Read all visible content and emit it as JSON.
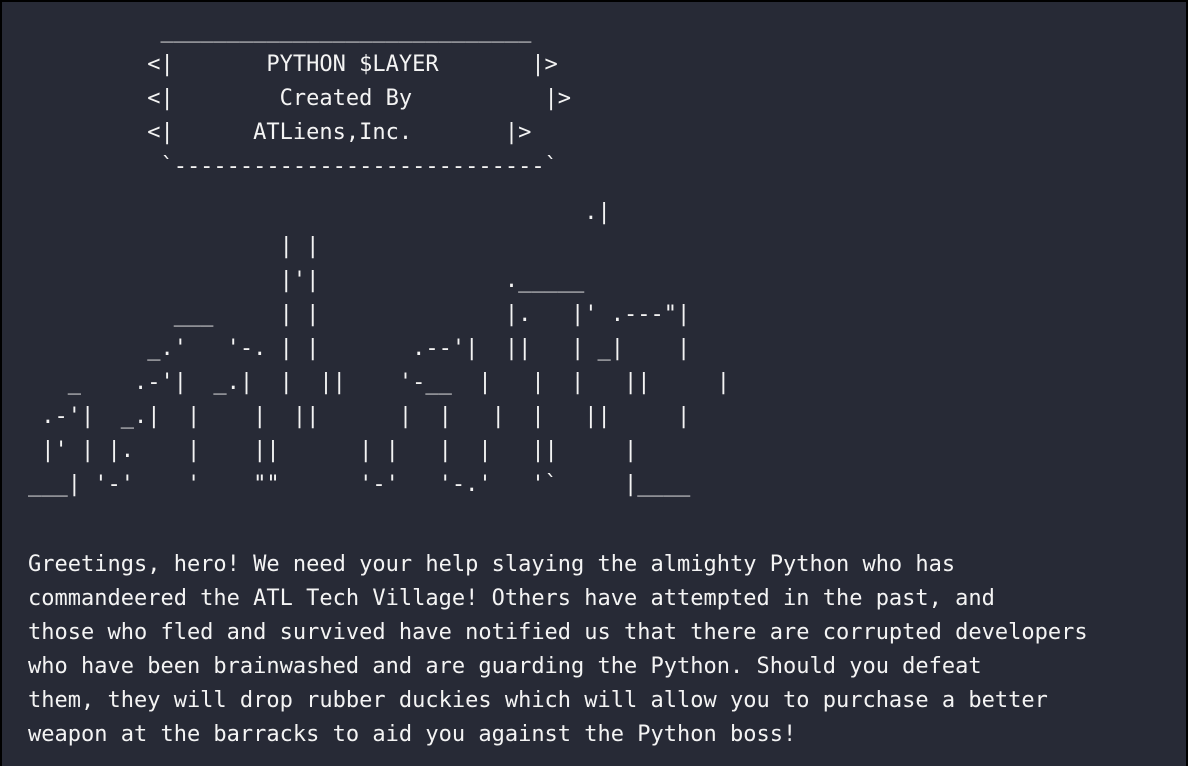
{
  "banner": {
    "top_border": "          ____________________________",
    "line1": "         <|       PYTHON $LAYER       |>",
    "line2": "         <|        Created By          |>",
    "line3": "         <|      ATLiens,Inc.       |>",
    "bottom_border": "          `----------------------------`"
  },
  "skyline": {
    "lines": [
      "                                          .|",
      "                   | |",
      "                   |'|              ._____",
      "           ___     | |              |.   |' .---\"|",
      "         _.'   '-. | |       .--'|  ||   | _|    |",
      "   _    .-'|  _.|  |  ||    '-__  |   |  |   ||     |",
      " .-'|  _.|  |    |  ||      |  |   |  |   ||     |",
      " |' | |.    |    ||      | |   |  |   ||     |",
      "___| '-'    '    \"\"      '-'   '-.'   '`     |____"
    ]
  },
  "message": {
    "lines": [
      "Greetings, hero! We need your help slaying the almighty Python who has",
      "commandeered the ATL Tech Village! Others have attempted in the past, and",
      "those who fled and survived have notified us that there are corrupted developers",
      "who have been brainwashed and are guarding the Python. Should you defeat",
      "them, they will drop rubber duckies which will allow you to purchase a better",
      "weapon at the barracks to aid you against the Python boss!"
    ]
  }
}
